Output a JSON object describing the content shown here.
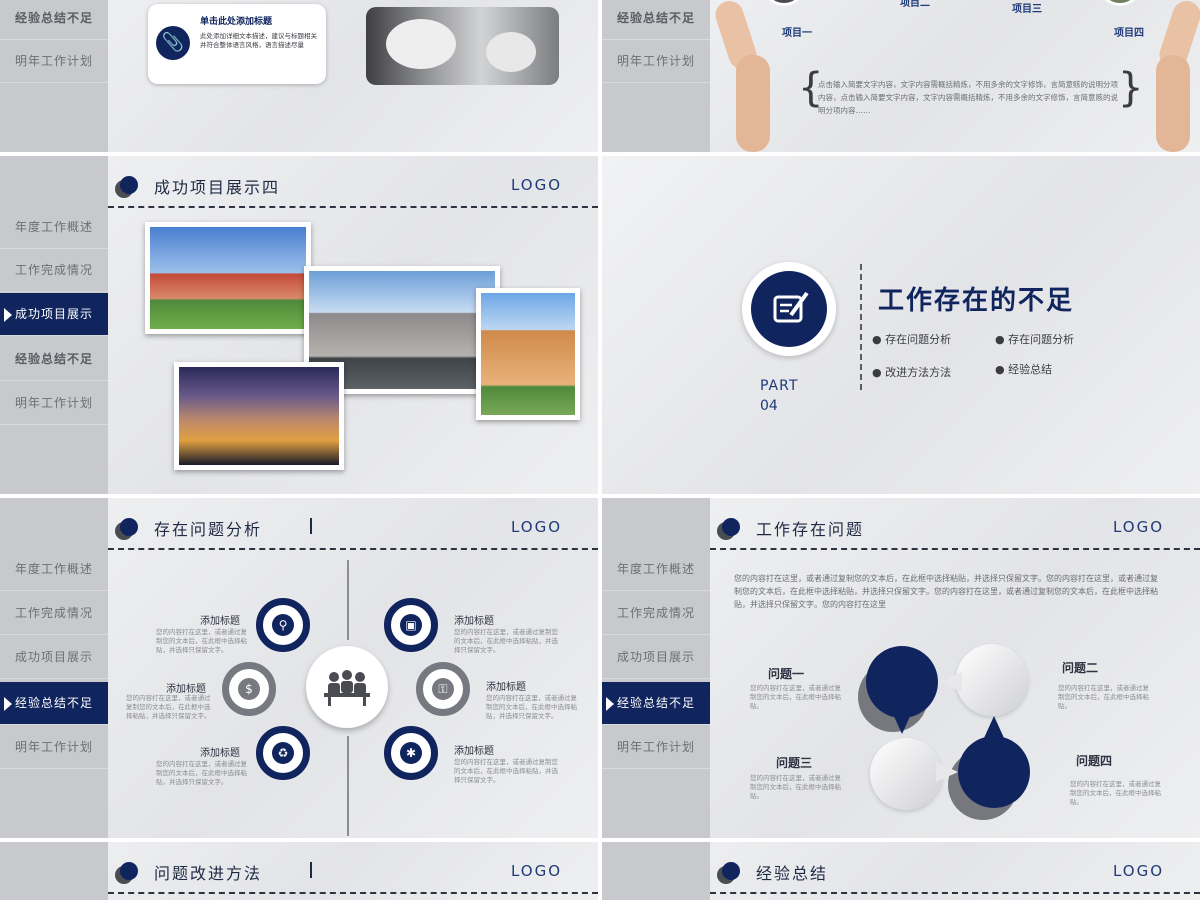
{
  "colors": {
    "navy": "#10245e",
    "grey": "#777980",
    "sidebar": "#c8c9cc"
  },
  "sidebar_labels": {
    "overview": "年度工作概述",
    "completion": "工作完成情况",
    "projects": "成功项目展示",
    "shortfalls": "经验总结不足",
    "next_year": "明年工作计划"
  },
  "logo": "LOGO",
  "slide_tl": {
    "card_title": "单击此处添加标题",
    "card_text": "此处添加详细文本描述，建议与标题相关并符合整体语言风格，语言描述尽量"
  },
  "slide_tr": {
    "items": [
      "项目一",
      "项目二",
      "项目三",
      "项目四"
    ],
    "text": "点击输入简要文字内容，文字内容需概括精炼，不用多余的文字修饰，言简意赅的说明分项内容，点击输入简要文字内容，文字内容需概括精炼，不用多余的文字修饰，言简意赅的说明分项内容……"
  },
  "slide_ml": {
    "title": "成功项目展示四"
  },
  "slide_mr": {
    "title": "工作存在的不足",
    "part": "PART",
    "part_num": "04",
    "bullets": [
      "存在问题分析",
      "存在问题分析",
      "改进方法方法",
      "经验总结"
    ]
  },
  "slide_bl": {
    "title": "存在问题分析",
    "items": [
      {
        "label": "添加标题",
        "text": "您的内容打在这里，或者通过复制您的文本后，在此框中选择粘贴，并选择只保留文字。"
      },
      {
        "label": "添加标题",
        "text": "您的内容打在这里，或者通过复制您的文本后，在此框中选择粘贴，并选择只保留文字。"
      },
      {
        "label": "添加标题",
        "text": "您的内容打在这里，或者通过复制您的文本后，在此框中选择粘贴，并选择只保留文字。"
      },
      {
        "label": "添加标题",
        "text": "您的内容打在这里，或者通过复制您的文本后，在此框中选择粘贴，并选择只保留文字。"
      },
      {
        "label": "添加标题",
        "text": "您的内容打在这里，或者通过复制您的文本后，在此框中选择粘贴，并选择只保留文字。"
      },
      {
        "label": "添加标题",
        "text": "您的内容打在这里，或者通过复制您的文本后，在此框中选择粘贴，并选择只保留文字。"
      }
    ]
  },
  "slide_br": {
    "title": "工作存在问题",
    "intro": "您的内容打在这里，或者通过复制您的文本后，在此框中选择粘贴，并选择只保留文字。您的内容打在这里，或者通过复制您的文本后，在此框中选择粘贴，并选择只保留文字。您的内容打在这里，或者通过复制您的文本后，在此框中选择粘贴，并选择只保留文字。您的内容打在这里",
    "issues": [
      {
        "label": "问题一",
        "text": "您的内容打在这里，或者通过复制您的文本后，在此框中选择粘贴。"
      },
      {
        "label": "问题二",
        "text": "您的内容打在这里，或者通过复制您的文本后，在此框中选择粘贴。"
      },
      {
        "label": "问题三",
        "text": "您的内容打在这里，或者通过复制您的文本后，在此框中选择粘贴。"
      },
      {
        "label": "问题四",
        "text": "您的内容打在这里，或者通过复制您的文本后，在此框中选择粘贴。"
      }
    ]
  },
  "slide_bottom_left": {
    "title": "问题改进方法"
  },
  "slide_bottom_right": {
    "title": "经验总结"
  }
}
